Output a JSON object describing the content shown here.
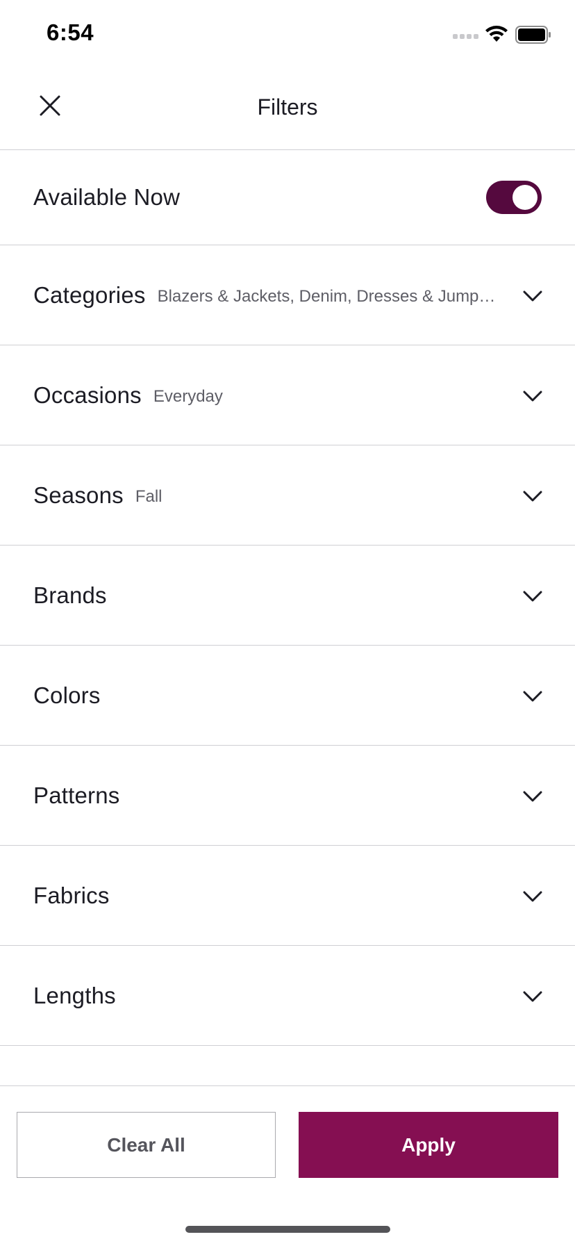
{
  "status_bar": {
    "time": "6:54"
  },
  "header": {
    "title": "Filters",
    "close_icon": "close-icon"
  },
  "available_now": {
    "label": "Available Now",
    "enabled": true,
    "accent": "#55093e"
  },
  "filters": [
    {
      "label": "Categories",
      "selected": "Blazers & Jackets, Denim, Dresses & Jumps..."
    },
    {
      "label": "Occasions",
      "selected": "Everyday"
    },
    {
      "label": "Seasons",
      "selected": "Fall"
    },
    {
      "label": "Brands",
      "selected": ""
    },
    {
      "label": "Colors",
      "selected": ""
    },
    {
      "label": "Patterns",
      "selected": ""
    },
    {
      "label": "Fabrics",
      "selected": ""
    },
    {
      "label": "Lengths",
      "selected": ""
    }
  ],
  "footer": {
    "clear_label": "Clear All",
    "apply_label": "Apply",
    "apply_color": "#850f52"
  }
}
